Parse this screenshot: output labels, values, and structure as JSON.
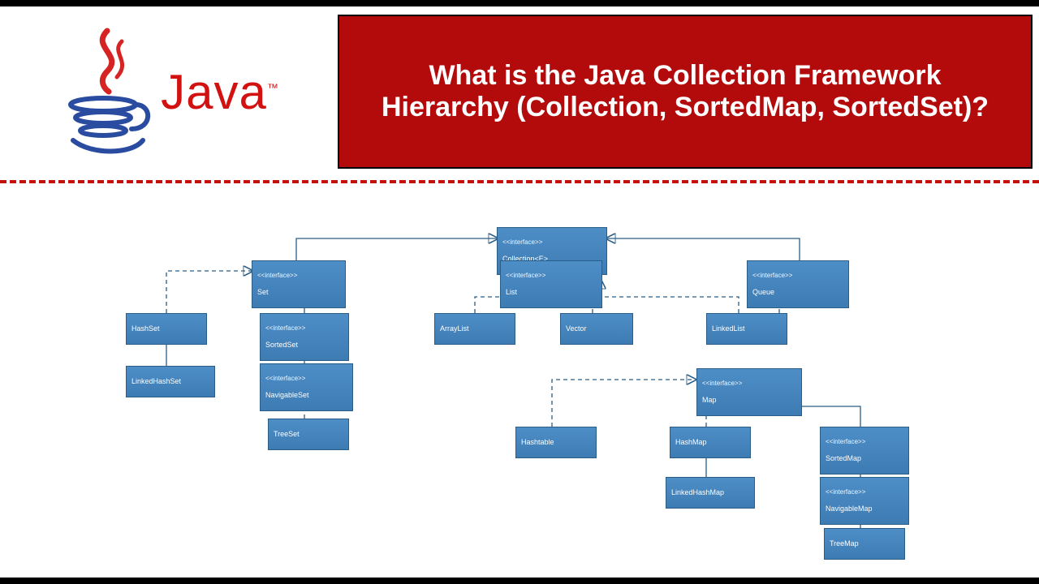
{
  "header": {
    "logo_word": "Java",
    "title": "What is the Java Collection Framework Hierarchy (Collection, SortedMap, SortedSet)?"
  },
  "nodes": {
    "collection": {
      "stereotype": "<<interface>>",
      "name": "Collection<E>"
    },
    "set": {
      "stereotype": "<<interface>>",
      "name": "Set"
    },
    "list": {
      "stereotype": "<<interface>>",
      "name": "List"
    },
    "queue": {
      "stereotype": "<<interface>>",
      "name": "Queue"
    },
    "hashset": {
      "stereotype": "",
      "name": "HashSet"
    },
    "sortedset": {
      "stereotype": "<<interface>>",
      "name": "SortedSet"
    },
    "linkedhashset": {
      "stereotype": "",
      "name": "LinkedHashSet"
    },
    "navigableset": {
      "stereotype": "<<interface>>",
      "name": "NavigableSet"
    },
    "treeset": {
      "stereotype": "",
      "name": "TreeSet"
    },
    "arraylist": {
      "stereotype": "",
      "name": "ArrayList"
    },
    "vector": {
      "stereotype": "",
      "name": "Vector"
    },
    "linkedlist": {
      "stereotype": "",
      "name": "LinkedList"
    },
    "map": {
      "stereotype": "<<interface>>",
      "name": "Map"
    },
    "hashmap": {
      "stereotype": "",
      "name": "HashMap"
    },
    "hashtable": {
      "stereotype": "",
      "name": "Hashtable"
    },
    "linkedhashmap": {
      "stereotype": "",
      "name": "LinkedHashMap"
    },
    "sortedmap": {
      "stereotype": "<<interface>>",
      "name": "SortedMap"
    },
    "navigablemap": {
      "stereotype": "<<interface>>",
      "name": "NavigableMap"
    },
    "treemap": {
      "stereotype": "",
      "name": "TreeMap"
    }
  }
}
